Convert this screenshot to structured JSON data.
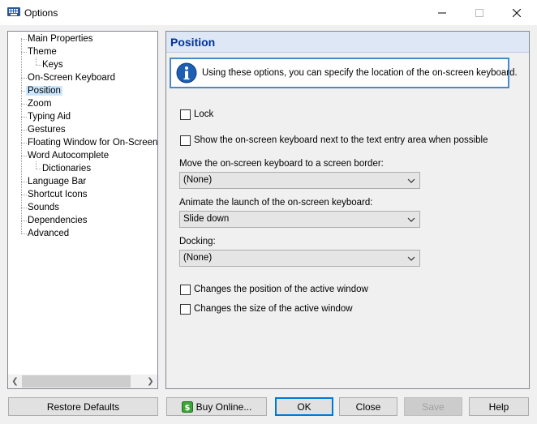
{
  "window": {
    "title": "Options"
  },
  "tree": {
    "items": [
      {
        "label": "Main Properties",
        "level": 0
      },
      {
        "label": "Theme",
        "level": 0
      },
      {
        "label": "Keys",
        "level": 1
      },
      {
        "label": "On-Screen Keyboard",
        "level": 0
      },
      {
        "label": "Position",
        "level": 0,
        "selected": true
      },
      {
        "label": "Zoom",
        "level": 0
      },
      {
        "label": "Typing Aid",
        "level": 0
      },
      {
        "label": "Gestures",
        "level": 0
      },
      {
        "label": "Floating Window for On-Screen Keyboard",
        "level": 0
      },
      {
        "label": "Word Autocomplete",
        "level": 0
      },
      {
        "label": "Dictionaries",
        "level": 1
      },
      {
        "label": "Language Bar",
        "level": 0
      },
      {
        "label": "Shortcut Icons",
        "level": 0
      },
      {
        "label": "Sounds",
        "level": 0
      },
      {
        "label": "Dependencies",
        "level": 0
      },
      {
        "label": "Advanced",
        "level": 0
      }
    ]
  },
  "panel": {
    "title": "Position",
    "info_text": "Using these options, you can specify the location of the on-screen keyboard.",
    "lock_label": "Lock",
    "show_next_label": "Show the on-screen keyboard next to the text entry area when possible",
    "border_label": "Move the on-screen keyboard to a screen border:",
    "border_value": "(None)",
    "animate_label": "Animate the launch of the on-screen keyboard:",
    "animate_value": "Slide down",
    "docking_label": "Docking:",
    "docking_value": "(None)",
    "changes_position_label": "Changes the position of the active window",
    "changes_size_label": "Changes the size of the active window"
  },
  "buttons": {
    "restore": "Restore Defaults",
    "buy": "Buy Online...",
    "ok": "OK",
    "close": "Close",
    "save": "Save",
    "help": "Help"
  },
  "colors": {
    "accent": "#0078d7",
    "header_bg": "#dde7f5",
    "header_text": "#003399",
    "selection": "#cce8ff"
  }
}
